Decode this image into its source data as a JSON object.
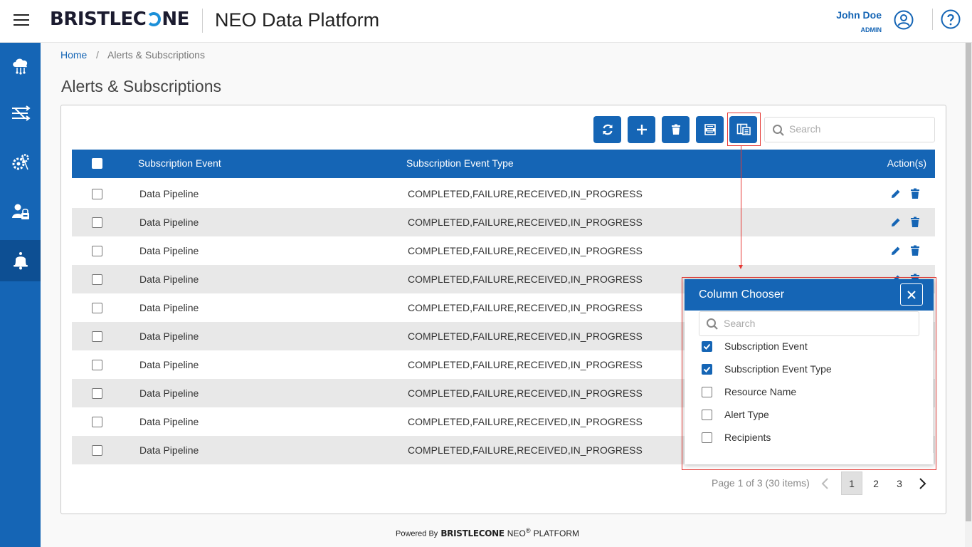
{
  "header": {
    "menu_icon": "hamburger-menu-icon",
    "brand": "BRISTLEC",
    "brand_tail": "NE",
    "app_title": "NEO Data Platform",
    "user_name": "John Doe",
    "user_role": "ADMIN",
    "user_icon": "user-circle-icon",
    "help_icon": "help-circle-icon"
  },
  "sidebar": {
    "items": [
      {
        "icon": "cloud-network-icon",
        "active": false
      },
      {
        "icon": "pipeline-flow-icon",
        "active": false
      },
      {
        "icon": "settings-gear-icon",
        "active": false
      },
      {
        "icon": "user-admin-icon",
        "active": false
      },
      {
        "icon": "bell-icon",
        "active": true
      }
    ]
  },
  "breadcrumb": {
    "home": "Home",
    "separator": "/",
    "current": "Alerts & Subscriptions"
  },
  "page_title": "Alerts & Subscriptions",
  "toolbar": {
    "buttons": [
      {
        "name": "refresh-button",
        "icon": "refresh-icon"
      },
      {
        "name": "add-button",
        "icon": "plus-icon"
      },
      {
        "name": "delete-button",
        "icon": "trash-icon"
      },
      {
        "name": "export-xlsx-button",
        "icon": "xlsx-file-icon"
      },
      {
        "name": "column-chooser-button",
        "icon": "column-chooser-icon"
      }
    ],
    "search_placeholder": "Search"
  },
  "table": {
    "columns": [
      "Subscription Event",
      "Subscription Event Type",
      "Action(s)"
    ],
    "rows": [
      {
        "event": "Data Pipeline",
        "type": "COMPLETED,FAILURE,RECEIVED,IN_PROGRESS"
      },
      {
        "event": "Data Pipeline",
        "type": "COMPLETED,FAILURE,RECEIVED,IN_PROGRESS"
      },
      {
        "event": "Data Pipeline",
        "type": "COMPLETED,FAILURE,RECEIVED,IN_PROGRESS"
      },
      {
        "event": "Data Pipeline",
        "type": "COMPLETED,FAILURE,RECEIVED,IN_PROGRESS"
      },
      {
        "event": "Data Pipeline",
        "type": "COMPLETED,FAILURE,RECEIVED,IN_PROGRESS"
      },
      {
        "event": "Data Pipeline",
        "type": "COMPLETED,FAILURE,RECEIVED,IN_PROGRESS"
      },
      {
        "event": "Data Pipeline",
        "type": "COMPLETED,FAILURE,RECEIVED,IN_PROGRESS"
      },
      {
        "event": "Data Pipeline",
        "type": "COMPLETED,FAILURE,RECEIVED,IN_PROGRESS"
      },
      {
        "event": "Data Pipeline",
        "type": "COMPLETED,FAILURE,RECEIVED,IN_PROGRESS"
      },
      {
        "event": "Data Pipeline",
        "type": "COMPLETED,FAILURE,RECEIVED,IN_PROGRESS"
      }
    ]
  },
  "pager": {
    "summary": "Page 1 of 3 (30 items)",
    "pages": [
      "1",
      "2",
      "3"
    ],
    "current": "1"
  },
  "column_chooser": {
    "title": "Column Chooser",
    "search_placeholder": "Search",
    "items": [
      {
        "label": "Subscription Event",
        "checked": true
      },
      {
        "label": "Subscription Event Type",
        "checked": true
      },
      {
        "label": "Resource Name",
        "checked": false
      },
      {
        "label": "Alert Type",
        "checked": false
      },
      {
        "label": "Recipients",
        "checked": false
      }
    ]
  },
  "footer": {
    "powered_by": "Powered By",
    "brand": "BRISTLECONE",
    "product": "NEO",
    "registered": "®",
    "platform": "PLATFORM"
  },
  "colors": {
    "primary": "#1565b5",
    "sidebar_active": "#0d4f93",
    "annotation": "#e53935"
  }
}
